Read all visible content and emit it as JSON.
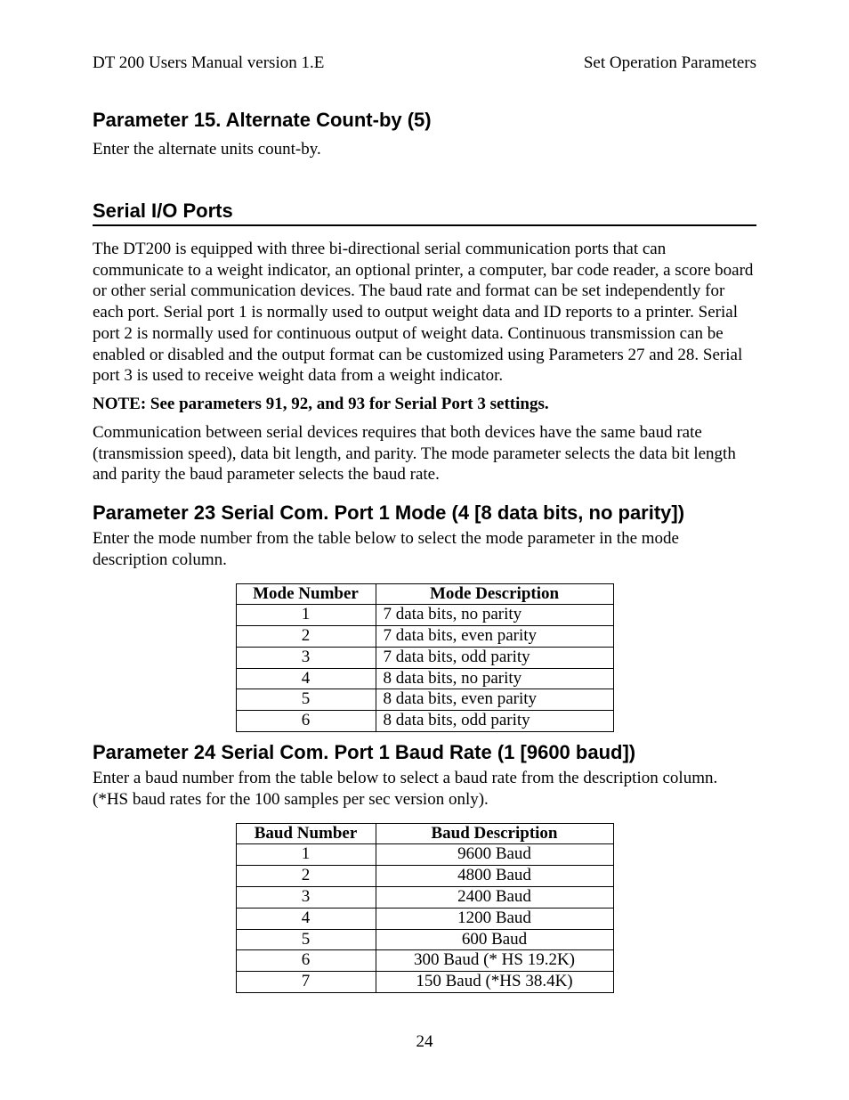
{
  "header": {
    "left": "DT 200 Users Manual version 1.E",
    "right": "Set Operation Parameters"
  },
  "sections": {
    "param15_title": "Parameter 15.  Alternate Count-by   (5)",
    "param15_body": "Enter the alternate units count-by.",
    "serial_title": "Serial I/O Ports",
    "serial_body1": "The DT200 is equipped with three bi-directional serial communication ports that can communicate to a weight indicator, an optional printer, a computer, bar code reader, a score board or other serial communication devices.  The baud rate and format can be set independently for each port.   Serial port 1 is normally used to output weight data and ID reports to a printer.  Serial port 2 is normally used for continuous output of weight data.  Continuous transmission can be enabled or disabled and the output format can be customized using Parameters 27 and 28.  Serial port 3 is used to receive weight data from a weight indicator.",
    "serial_note": "NOTE: See parameters 91, 92, and 93 for Serial Port 3 settings.",
    "serial_body2": "Communication between serial devices requires that both devices have the same baud rate (transmission speed), data bit length, and parity.  The mode parameter selects the data bit length and parity the baud parameter selects the baud rate.",
    "param23_title": "Parameter 23 Serial Com. Port 1 Mode   (4 [8 data bits, no parity])",
    "param23_body": "Enter the mode number from the table below to select the mode parameter in the mode description column.",
    "param24_title": "Parameter 24 Serial Com. Port 1 Baud Rate   (1 [9600 baud])",
    "param24_body": "Enter a baud number from the table below to select a baud rate from the description column. (*HS baud rates for the 100 samples per sec version only)."
  },
  "mode_table": {
    "headers": [
      "Mode Number",
      "Mode Description"
    ],
    "rows": [
      {
        "n": "1",
        "d": "7 data bits, no parity"
      },
      {
        "n": "2",
        "d": "7 data bits, even parity"
      },
      {
        "n": "3",
        "d": "7 data bits, odd parity"
      },
      {
        "n": "4",
        "d": "8 data bits, no parity"
      },
      {
        "n": "5",
        "d": "8 data bits, even parity"
      },
      {
        "n": "6",
        "d": "8 data bits, odd parity"
      }
    ]
  },
  "baud_table": {
    "headers": [
      "Baud Number",
      "Baud Description"
    ],
    "rows": [
      {
        "n": "1",
        "d": "9600 Baud"
      },
      {
        "n": "2",
        "d": "4800 Baud"
      },
      {
        "n": "3",
        "d": "2400 Baud"
      },
      {
        "n": "4",
        "d": "1200 Baud"
      },
      {
        "n": "5",
        "d": "600 Baud"
      },
      {
        "n": "6",
        "d": "300 Baud  (* HS 19.2K)"
      },
      {
        "n": "7",
        "d": "150 Baud  (*HS 38.4K)"
      }
    ]
  },
  "page_number": "24"
}
